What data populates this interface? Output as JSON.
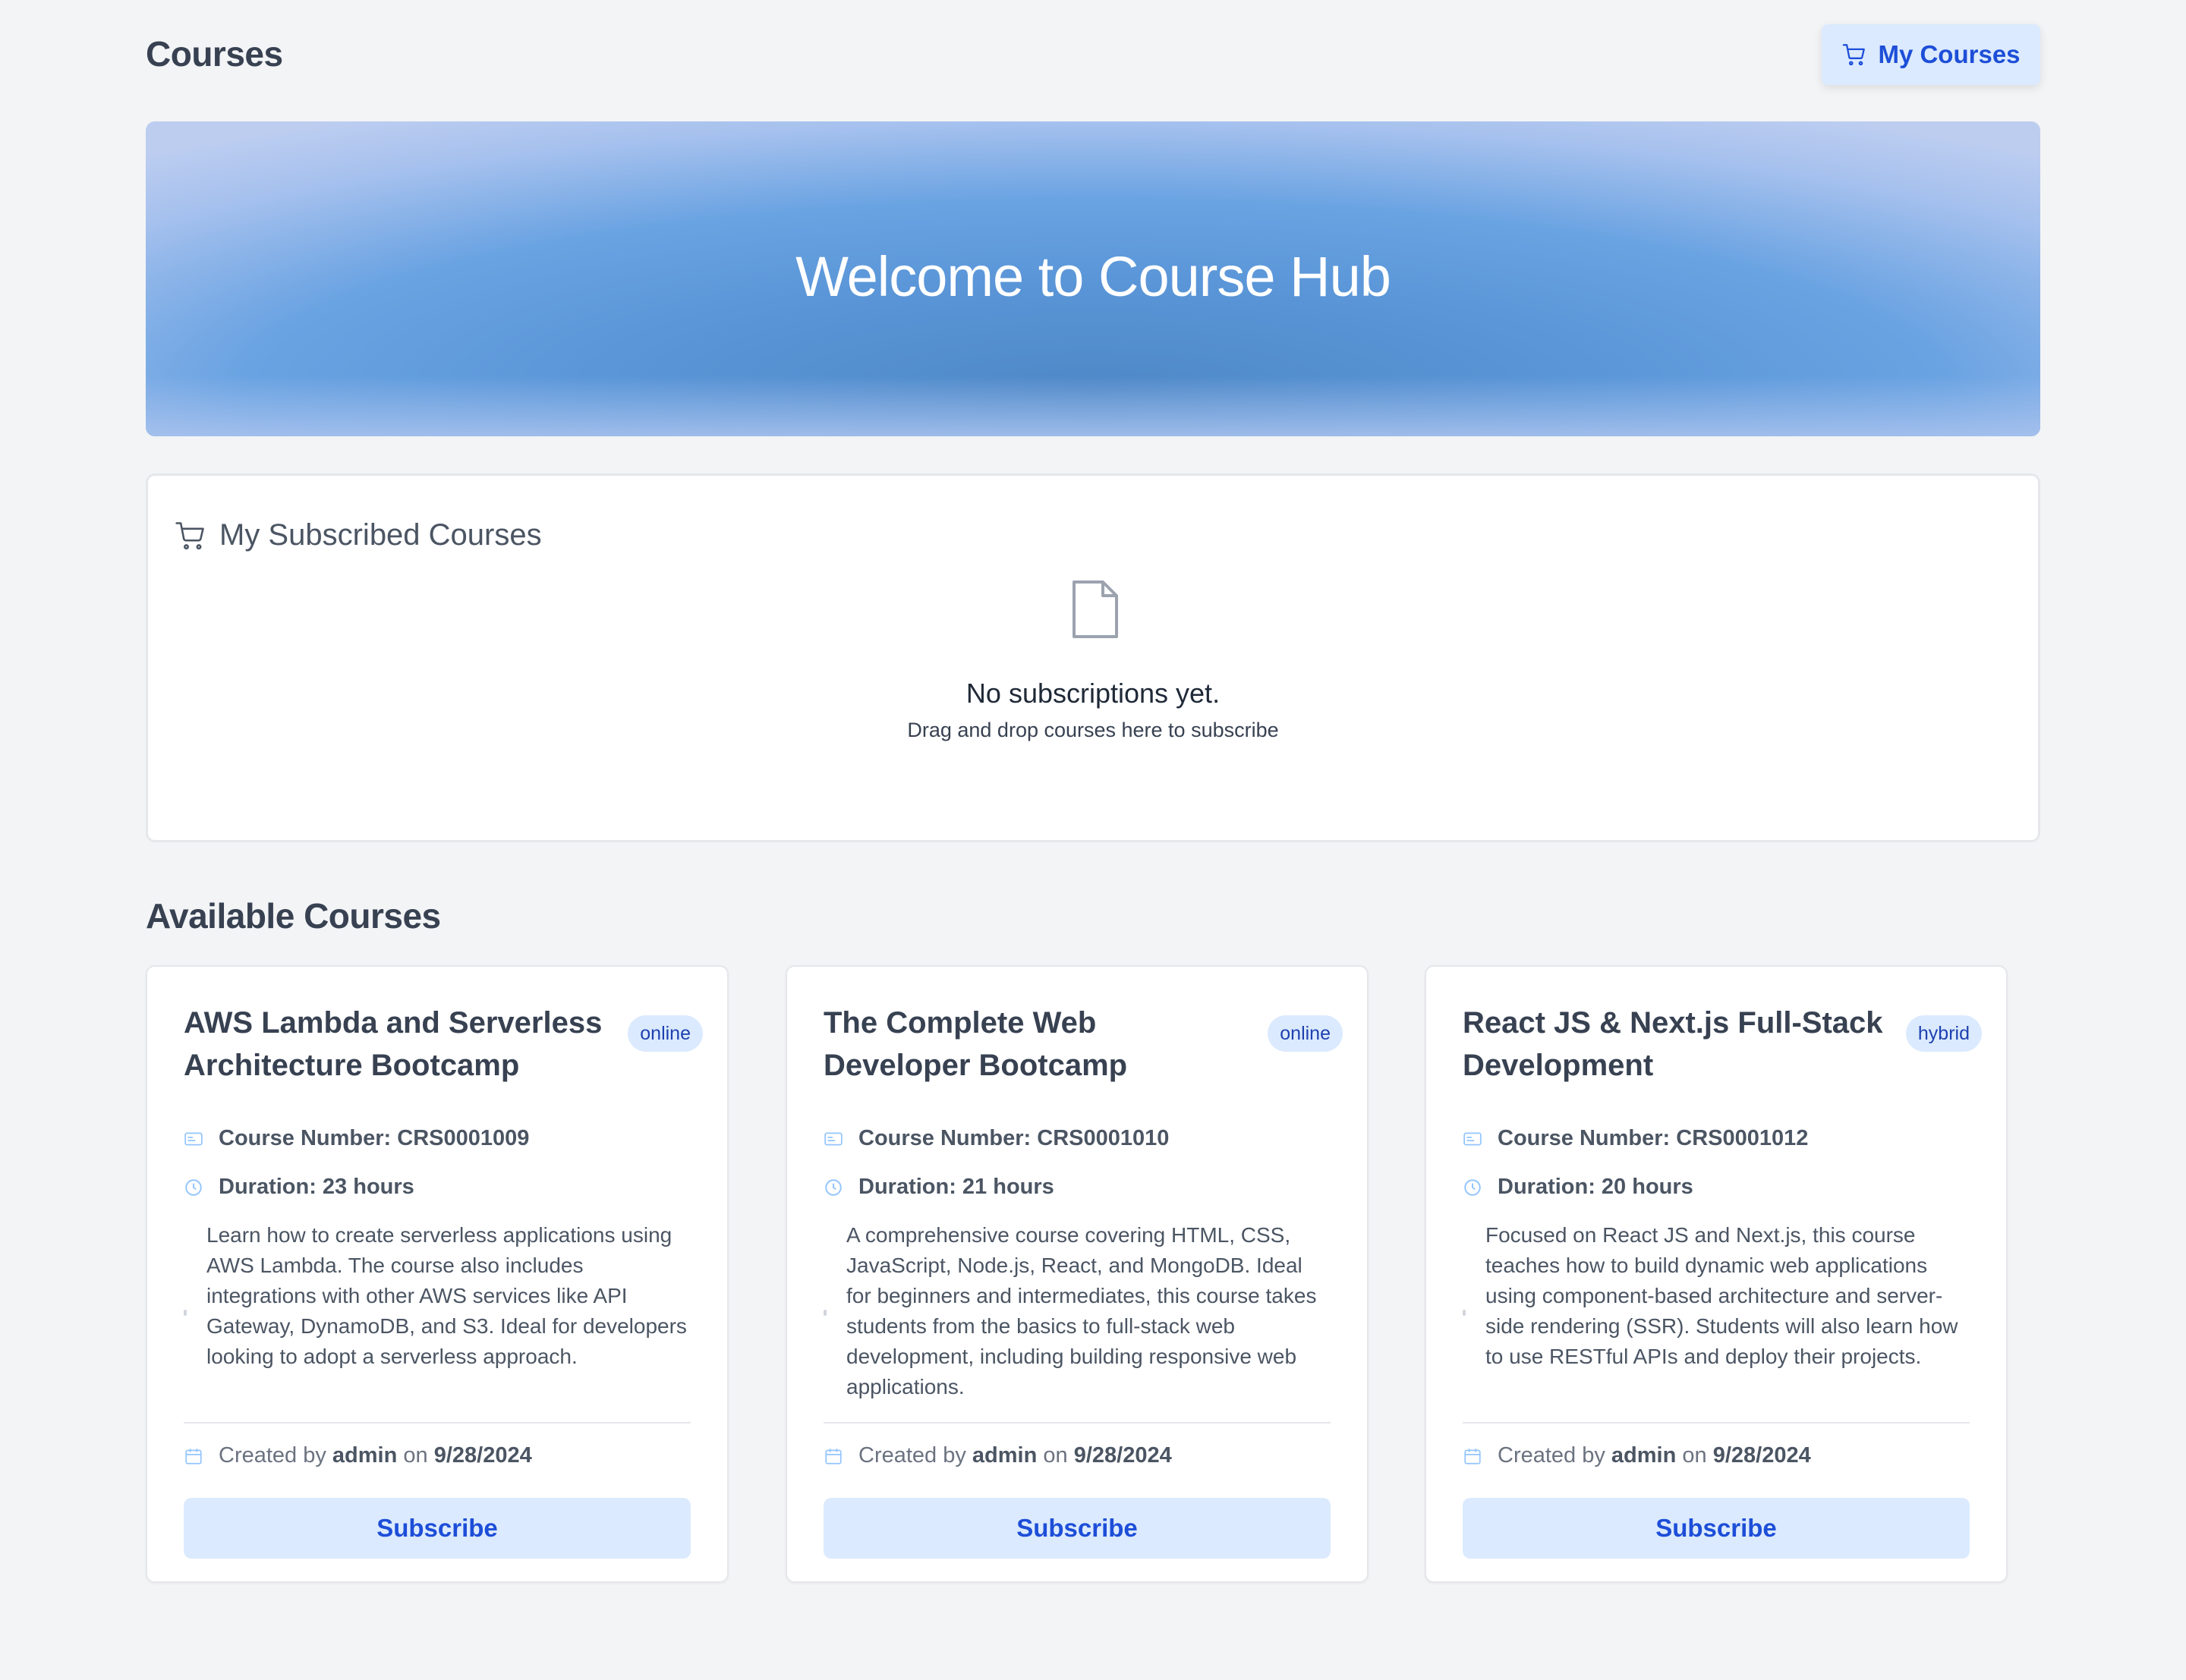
{
  "header": {
    "title": "Courses",
    "my_courses_label": "My Courses"
  },
  "hero": {
    "title": "Welcome to Course Hub"
  },
  "subscribed": {
    "title": "My Subscribed Courses",
    "empty_title": "No subscriptions yet.",
    "empty_subtitle": "Drag and drop courses here to subscribe"
  },
  "available": {
    "title": "Available Courses",
    "courses": [
      {
        "title": "AWS Lambda and Serverless Architecture Bootcamp",
        "mode": "online",
        "course_number": "Course Number: CRS0001009",
        "duration": "Duration: 23 hours",
        "description": "Learn how to create serverless applications using AWS Lambda. The course also includes integrations with other AWS services like API Gateway, DynamoDB, and S3. Ideal for developers looking to adopt a serverless approach.",
        "created_prefix": "Created by",
        "created_by": "admin",
        "created_on_prefix": "on",
        "created_date": "9/28/2024",
        "subscribe_label": "Subscribe"
      },
      {
        "title": "The Complete Web Developer Bootcamp",
        "mode": "online",
        "course_number": "Course Number: CRS0001010",
        "duration": "Duration: 21 hours",
        "description": "A comprehensive course covering HTML, CSS, JavaScript, Node.js, React, and MongoDB. Ideal for beginners and intermediates, this course takes students from the basics to full-stack web development, including building responsive web applications.",
        "created_prefix": "Created by",
        "created_by": "admin",
        "created_on_prefix": "on",
        "created_date": "9/28/2024",
        "subscribe_label": "Subscribe"
      },
      {
        "title": "React JS & Next.js Full-Stack Development",
        "mode": "hybrid",
        "course_number": "Course Number: CRS0001012",
        "duration": "Duration: 20 hours",
        "description": "Focused on React JS and Next.js, this course teaches how to build dynamic web applications using component-based architecture and server-side rendering (SSR). Students will also learn how to use RESTful APIs and deploy their projects.",
        "created_prefix": "Created by",
        "created_by": "admin",
        "created_on_prefix": "on",
        "created_date": "9/28/2024",
        "subscribe_label": "Subscribe"
      }
    ]
  },
  "icons": {
    "cart": "shopping-cart-icon",
    "document": "document-icon",
    "id_card": "id-card-icon",
    "clock": "clock-icon",
    "calendar": "calendar-icon"
  },
  "colors": {
    "accent": "#1d4ed8",
    "accent_bg": "#dbeafe",
    "page_bg": "#f3f4f6",
    "hero_blue": "#5a96d8"
  }
}
